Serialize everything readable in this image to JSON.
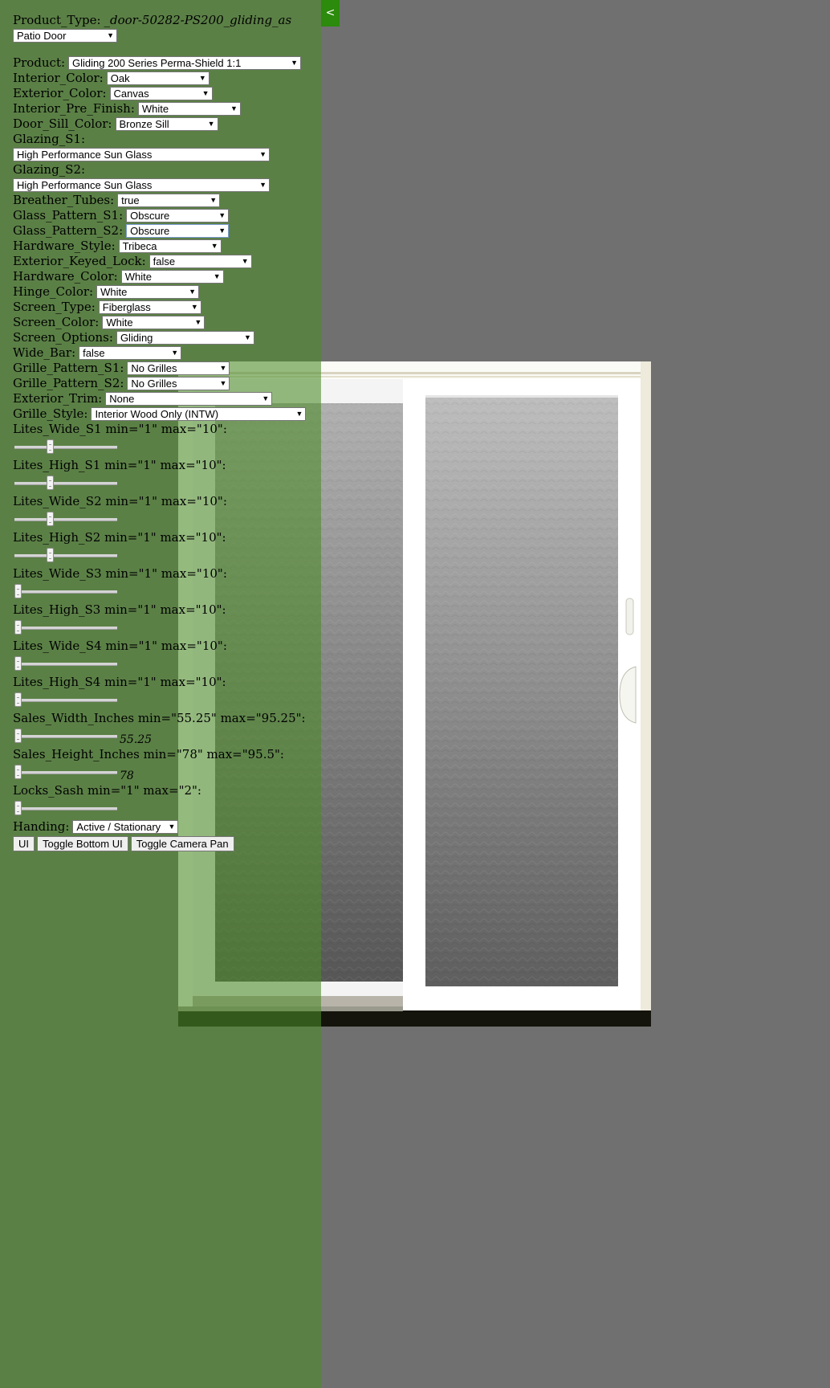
{
  "panel": {
    "collapse_label": "<",
    "product_type_label": "Product_Type:",
    "product_type_value": "_door-50282-PS200_gliding_as",
    "category_select": "Patio Door",
    "product_label": "Product:",
    "product_select": "Gliding 200 Series Perma-Shield 1:1",
    "fields": [
      {
        "label": "Interior_Color:",
        "value": "Oak"
      },
      {
        "label": "Exterior_Color:",
        "value": "Canvas"
      },
      {
        "label": "Interior_Pre_Finish:",
        "value": "White"
      },
      {
        "label": "Door_Sill_Color:",
        "value": "Bronze Sill"
      }
    ],
    "glazing_s1_label": "Glazing_S1:",
    "glazing_s1_value": "High Performance Sun Glass",
    "glazing_s2_label": "Glazing_S2:",
    "glazing_s2_value": "High Performance Sun Glass",
    "fields2": [
      {
        "label": "Breather_Tubes:",
        "value": "true"
      },
      {
        "label": "Glass_Pattern_S1:",
        "value": "Obscure"
      },
      {
        "label": "Glass_Pattern_S2:",
        "value": "Obscure"
      },
      {
        "label": "Hardware_Style:",
        "value": "Tribeca"
      },
      {
        "label": "Exterior_Keyed_Lock:",
        "value": "false"
      },
      {
        "label": "Hardware_Color:",
        "value": "White"
      },
      {
        "label": "Hinge_Color:",
        "value": "White"
      },
      {
        "label": "Screen_Type:",
        "value": "Fiberglass"
      },
      {
        "label": "Screen_Color:",
        "value": "White"
      },
      {
        "label": "Screen_Options:",
        "value": "Gliding"
      },
      {
        "label": "Wide_Bar:",
        "value": "false"
      },
      {
        "label": "Grille_Pattern_S1:",
        "value": "No Grilles"
      },
      {
        "label": "Grille_Pattern_S2:",
        "value": "No Grilles"
      },
      {
        "label": "Exterior_Trim:",
        "value": "None"
      },
      {
        "label": "Grille_Style:",
        "value": "Interior Wood Only (INTW)"
      }
    ],
    "sliders": [
      {
        "label": "Lites_Wide_S1 min=\"1\" max=\"10\":",
        "min": 1,
        "max": 10,
        "value": 3,
        "display": ""
      },
      {
        "label": "Lites_High_S1 min=\"1\" max=\"10\":",
        "min": 1,
        "max": 10,
        "value": 3,
        "display": ""
      },
      {
        "label": "Lites_Wide_S2 min=\"1\" max=\"10\":",
        "min": 1,
        "max": 10,
        "value": 3,
        "display": ""
      },
      {
        "label": "Lites_High_S2 min=\"1\" max=\"10\":",
        "min": 1,
        "max": 10,
        "value": 3,
        "display": ""
      },
      {
        "label": "Lites_Wide_S3 min=\"1\" max=\"10\":",
        "min": 1,
        "max": 10,
        "value": 1,
        "display": ""
      },
      {
        "label": "Lites_High_S3 min=\"1\" max=\"10\":",
        "min": 1,
        "max": 10,
        "value": 1,
        "display": ""
      },
      {
        "label": "Lites_Wide_S4 min=\"1\" max=\"10\":",
        "min": 1,
        "max": 10,
        "value": 1,
        "display": ""
      },
      {
        "label": "Lites_High_S4 min=\"1\" max=\"10\":",
        "min": 1,
        "max": 10,
        "value": 1,
        "display": ""
      },
      {
        "label": "Sales_Width_Inches min=\"55.25\" max=\"95.25\":",
        "min": 55.25,
        "max": 95.25,
        "value": 55.25,
        "display": "55.25"
      },
      {
        "label": "Sales_Height_Inches min=\"78\" max=\"95.5\":",
        "min": 78,
        "max": 95.5,
        "value": 78,
        "display": "78"
      },
      {
        "label": "Locks_Sash min=\"1\" max=\"2\":",
        "min": 1,
        "max": 2,
        "value": 1,
        "display": ""
      }
    ],
    "handing_label": "Handing:",
    "handing_value": "Active / Stationary",
    "buttons": {
      "ui": "UI",
      "toggle_bottom": "Toggle Bottom UI",
      "toggle_camera": "Toggle Camera Pan"
    }
  },
  "colors": {
    "viewport_bg": "#707070",
    "panel_bg": "rgba(76,140,40,0.58)",
    "collapse_btn": "#2c8a0c",
    "frame": "#fbfbf6"
  }
}
